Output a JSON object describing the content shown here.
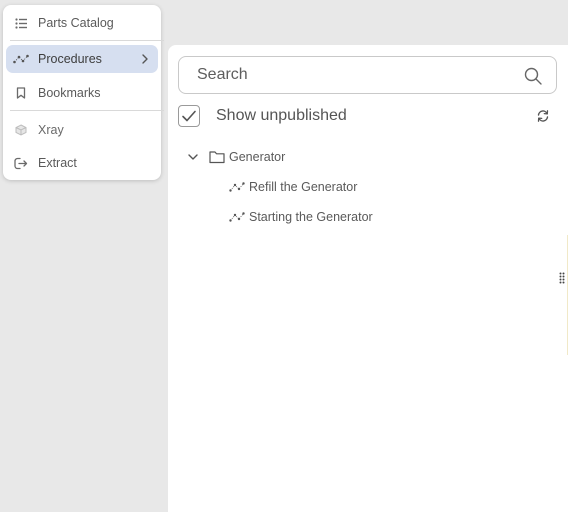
{
  "menu": {
    "items": [
      {
        "label": "Parts Catalog",
        "icon": "list-icon",
        "active": false
      },
      {
        "label": "Procedures",
        "icon": "procedure-icon",
        "active": true,
        "has_submenu": true
      },
      {
        "label": "Bookmarks",
        "icon": "bookmark-icon",
        "active": false
      },
      {
        "label": "Xray",
        "icon": "cube-icon",
        "active": false
      },
      {
        "label": "Extract",
        "icon": "extract-icon",
        "active": false
      }
    ]
  },
  "panel": {
    "search": {
      "placeholder": "Search",
      "value": ""
    },
    "show_unpublished": {
      "label": "Show unpublished",
      "checked": true
    },
    "tree": {
      "folder": {
        "label": "Generator",
        "expanded": true
      },
      "procedures": [
        {
          "label": "Refill the Generator"
        },
        {
          "label": "Starting the Generator"
        }
      ]
    }
  },
  "colors": {
    "active_menu_bg": "#d6dff0",
    "background": "#e8e8e8",
    "panel_bg": "#ffffff",
    "text": "#555555"
  }
}
